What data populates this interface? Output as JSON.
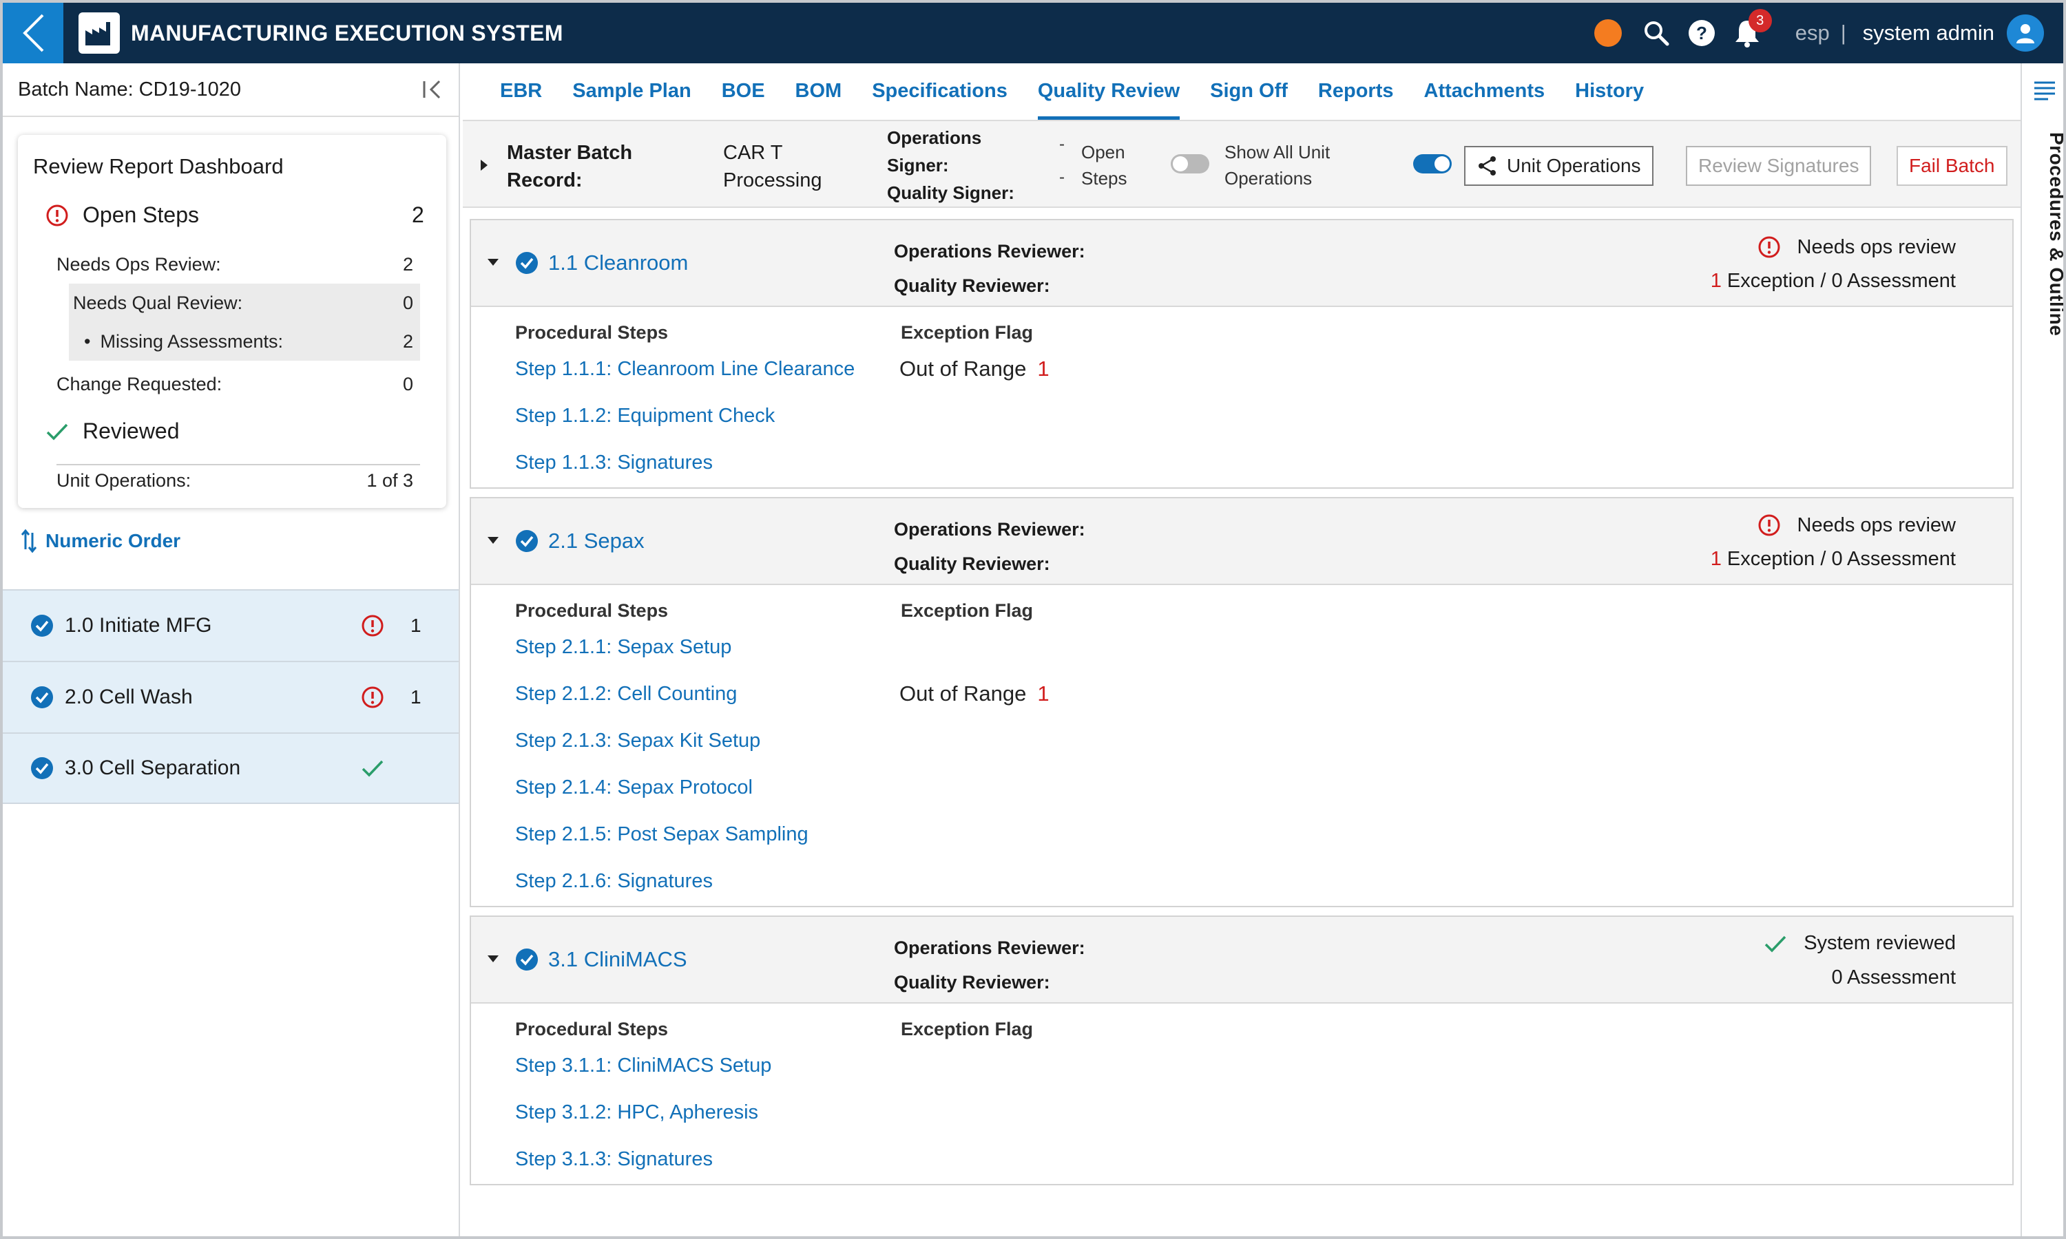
{
  "app": {
    "title": "MANUFACTURING EXECUTION SYSTEM",
    "lang": "esp",
    "sep": "|",
    "user": "system admin",
    "notifications": "3",
    "accent": "#1270b8",
    "header_bg": "#0d2c4a",
    "status_dot": "#f47c20"
  },
  "left": {
    "batch_name": "Batch Name: CD19-1020",
    "dashboard": {
      "title": "Review Report Dashboard",
      "open_steps": {
        "label": "Open Steps",
        "count": "2"
      },
      "rows": [
        {
          "label": "Needs Ops Review:",
          "value": "2"
        },
        {
          "label": "Needs Qual Review:",
          "value": "0"
        },
        {
          "label": "Missing Assessments:",
          "value": "2",
          "bullet": "•"
        },
        {
          "label": "Change Requested:",
          "value": "0"
        }
      ],
      "reviewed": {
        "label": "Reviewed",
        "unit_label": "Unit Operations:",
        "unit_value": "1 of 3"
      }
    },
    "sort_label": "Numeric Order",
    "units": [
      {
        "name": "1.0 Initiate MFG",
        "status": "exception",
        "count": "1"
      },
      {
        "name": "2.0 Cell Wash",
        "status": "exception",
        "count": "1"
      },
      {
        "name": "3.0 Cell Separation",
        "status": "reviewed",
        "count": ""
      }
    ]
  },
  "tabs": [
    {
      "label": "EBR"
    },
    {
      "label": "Sample Plan"
    },
    {
      "label": "BOE"
    },
    {
      "label": "BOM"
    },
    {
      "label": "Specifications"
    },
    {
      "label": "Quality Review",
      "active": true
    },
    {
      "label": "Sign Off"
    },
    {
      "label": "Reports"
    },
    {
      "label": "Attachments"
    },
    {
      "label": "History"
    }
  ],
  "toolbar": {
    "mbr_line1": "Master Batch",
    "mbr_line2": "Record:",
    "product_line1": "CAR T",
    "product_line2": "Processing",
    "ops_signer_line1": "Operations",
    "ops_signer_line2": "Signer:",
    "quality_signer": "Quality Signer:",
    "ops_signer_value": "-",
    "quality_signer_value": "-",
    "open_line1": "Open",
    "open_line2": "Steps",
    "showall_line1": "Show All Unit",
    "showall_line2": "Operations",
    "unit_ops_btn": "Unit Operations",
    "review_sig_btn": "Review Signatures",
    "fail_btn": "Fail Batch"
  },
  "cards": [
    {
      "name": "1.1 Cleanroom",
      "ops_reviewer": "Operations Reviewer:",
      "quality_reviewer": "Quality Reviewer:",
      "status": "Needs ops review",
      "status_type": "warn",
      "exc_count": "1",
      "exc_text": " Exception / 0 Assessment",
      "steps_header": "Procedural Steps",
      "flag_header": "Exception Flag",
      "steps": [
        {
          "label": "Step 1.1.1: Cleanroom Line Clearance",
          "flag": "Out of Range",
          "flag_count": "1"
        },
        {
          "label": "Step 1.1.2: Equipment Check",
          "flag": "",
          "flag_count": ""
        },
        {
          "label": "Step 1.1.3: Signatures",
          "flag": "",
          "flag_count": ""
        }
      ]
    },
    {
      "name": "2.1 Sepax",
      "ops_reviewer": "Operations Reviewer:",
      "quality_reviewer": "Quality Reviewer:",
      "status": "Needs ops review",
      "status_type": "warn",
      "exc_count": "1",
      "exc_text": " Exception / 0 Assessment",
      "steps_header": "Procedural Steps",
      "flag_header": "Exception Flag",
      "steps": [
        {
          "label": "Step 2.1.1: Sepax Setup",
          "flag": "",
          "flag_count": ""
        },
        {
          "label": "Step 2.1.2: Cell Counting",
          "flag": "Out of Range",
          "flag_count": "1"
        },
        {
          "label": "Step 2.1.3: Sepax Kit Setup",
          "flag": "",
          "flag_count": ""
        },
        {
          "label": "Step 2.1.4: Sepax Protocol",
          "flag": "",
          "flag_count": ""
        },
        {
          "label": "Step 2.1.5: Post Sepax Sampling",
          "flag": "",
          "flag_count": ""
        },
        {
          "label": "Step 2.1.6: Signatures",
          "flag": "",
          "flag_count": ""
        }
      ]
    },
    {
      "name": "3.1 CliniMACS",
      "ops_reviewer": "Operations Reviewer:",
      "quality_reviewer": "Quality Reviewer:",
      "status": "System reviewed",
      "status_type": "ok",
      "exc_count": "",
      "exc_text": "0 Assessment",
      "steps_header": "Procedural Steps",
      "flag_header": "Exception Flag",
      "steps": [
        {
          "label": "Step 3.1.1: CliniMACS Setup",
          "flag": "",
          "flag_count": ""
        },
        {
          "label": "Step 3.1.2: HPC, Apheresis",
          "flag": "",
          "flag_count": ""
        },
        {
          "label": "Step 3.1.3: Signatures",
          "flag": "",
          "flag_count": ""
        }
      ]
    }
  ],
  "rail": {
    "label": "Procedures & Outline"
  }
}
